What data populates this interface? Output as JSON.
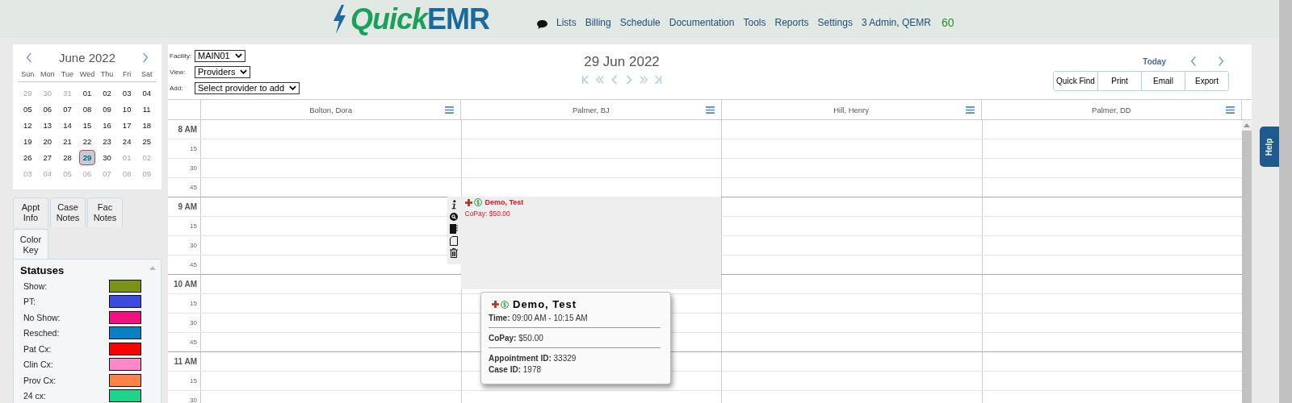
{
  "header": {
    "logo": {
      "first": "Quick",
      "second": "EMR"
    },
    "nav": [
      "Lists",
      "Billing",
      "Schedule",
      "Documentation",
      "Tools",
      "Reports",
      "Settings",
      "3 Admin, QEMR"
    ],
    "counter": "60"
  },
  "mini_calendar": {
    "month": "June 2022",
    "weekdays": [
      "Sun",
      "Mon",
      "Tue",
      "Wed",
      "Thu",
      "Fri",
      "Sat"
    ],
    "weeks": [
      [
        {
          "day": "29",
          "muted": true,
          "selected": false
        },
        {
          "day": "30",
          "muted": true,
          "selected": false
        },
        {
          "day": "31",
          "muted": true,
          "selected": false
        },
        {
          "day": "01",
          "muted": false,
          "selected": false
        },
        {
          "day": "02",
          "muted": false,
          "selected": false
        },
        {
          "day": "03",
          "muted": false,
          "selected": false
        },
        {
          "day": "04",
          "muted": false,
          "selected": false
        }
      ],
      [
        {
          "day": "05",
          "muted": false,
          "selected": false
        },
        {
          "day": "06",
          "muted": false,
          "selected": false
        },
        {
          "day": "07",
          "muted": false,
          "selected": false
        },
        {
          "day": "08",
          "muted": false,
          "selected": false
        },
        {
          "day": "09",
          "muted": false,
          "selected": false
        },
        {
          "day": "10",
          "muted": false,
          "selected": false
        },
        {
          "day": "11",
          "muted": false,
          "selected": false
        }
      ],
      [
        {
          "day": "12",
          "muted": false,
          "selected": false
        },
        {
          "day": "13",
          "muted": false,
          "selected": false
        },
        {
          "day": "14",
          "muted": false,
          "selected": false
        },
        {
          "day": "15",
          "muted": false,
          "selected": false
        },
        {
          "day": "16",
          "muted": false,
          "selected": false
        },
        {
          "day": "17",
          "muted": false,
          "selected": false
        },
        {
          "day": "18",
          "muted": false,
          "selected": false
        }
      ],
      [
        {
          "day": "19",
          "muted": false,
          "selected": false
        },
        {
          "day": "20",
          "muted": false,
          "selected": false
        },
        {
          "day": "21",
          "muted": false,
          "selected": false
        },
        {
          "day": "22",
          "muted": false,
          "selected": false
        },
        {
          "day": "23",
          "muted": false,
          "selected": false
        },
        {
          "day": "24",
          "muted": false,
          "selected": false
        },
        {
          "day": "25",
          "muted": false,
          "selected": false
        }
      ],
      [
        {
          "day": "26",
          "muted": false,
          "selected": false
        },
        {
          "day": "27",
          "muted": false,
          "selected": false
        },
        {
          "day": "28",
          "muted": false,
          "selected": false
        },
        {
          "day": "29",
          "muted": false,
          "selected": true
        },
        {
          "day": "30",
          "muted": false,
          "selected": false
        },
        {
          "day": "01",
          "muted": true,
          "selected": false
        },
        {
          "day": "02",
          "muted": true,
          "selected": false
        }
      ],
      [
        {
          "day": "03",
          "muted": true,
          "selected": false
        },
        {
          "day": "04",
          "muted": true,
          "selected": false
        },
        {
          "day": "05",
          "muted": true,
          "selected": false
        },
        {
          "day": "06",
          "muted": true,
          "selected": false
        },
        {
          "day": "07",
          "muted": true,
          "selected": false
        },
        {
          "day": "08",
          "muted": true,
          "selected": false
        },
        {
          "day": "09",
          "muted": true,
          "selected": false
        }
      ]
    ]
  },
  "side_tabs": [
    {
      "label": "Appt Info",
      "selected": false
    },
    {
      "label": "Case Notes",
      "selected": false
    },
    {
      "label": "Fac Notes",
      "selected": false
    },
    {
      "label": "Color Key",
      "selected": true
    }
  ],
  "color_key": {
    "title": "Statuses",
    "items": [
      {
        "label": "Show:",
        "color": "#7a9419"
      },
      {
        "label": "PT:",
        "color": "#3a4be0"
      },
      {
        "label": "No Show:",
        "color": "#f20f7f"
      },
      {
        "label": "Resched:",
        "color": "#0a80c4"
      },
      {
        "label": "Pat Cx:",
        "color": "#ff0000"
      },
      {
        "label": "Clin Cx:",
        "color": "#ff88c8"
      },
      {
        "label": "Prov Cx:",
        "color": "#ff8344"
      },
      {
        "label": "24 cx:",
        "color": "#1fd38a"
      }
    ]
  },
  "toolbar": {
    "filters": [
      {
        "label": "Facility:",
        "value": "MAIN01"
      },
      {
        "label": "View:",
        "value": "Providers"
      },
      {
        "label": "Add:",
        "value": "Select provider to add"
      }
    ],
    "date": "29 Jun 2022",
    "today": "Today",
    "buttons": [
      "Quick Find",
      "Print",
      "Email",
      "Export"
    ]
  },
  "providers": [
    {
      "name": "Bolton, Dora"
    },
    {
      "name": "Palmer, BJ",
      "appointments": [
        {
          "name": "Demo, Test",
          "copay_label": "CoPay:",
          "copay": "$50.00"
        }
      ]
    },
    {
      "name": "Hill, Henry"
    },
    {
      "name": "Palmer, DD"
    }
  ],
  "time_slots": [
    {
      "label": "8 AM",
      "kind": "hour"
    },
    {
      "label": "15",
      "kind": "quarter"
    },
    {
      "label": "30",
      "kind": "quarter"
    },
    {
      "label": "45",
      "kind": "quarter"
    },
    {
      "label": "9 AM",
      "kind": "hour"
    },
    {
      "label": "15",
      "kind": "quarter"
    },
    {
      "label": "30",
      "kind": "quarter"
    },
    {
      "label": "45",
      "kind": "quarter"
    },
    {
      "label": "10 AM",
      "kind": "hour"
    },
    {
      "label": "15",
      "kind": "quarter"
    },
    {
      "label": "30",
      "kind": "quarter"
    },
    {
      "label": "45",
      "kind": "quarter"
    },
    {
      "label": "11 AM",
      "kind": "hour"
    },
    {
      "label": "15",
      "kind": "quarter"
    },
    {
      "label": "30",
      "kind": "quarter"
    }
  ],
  "tooltip": {
    "name": "Demo, Test",
    "groups": [
      [
        {
          "label": "Time:",
          "value": "09:00 AM - 10:15 AM"
        }
      ],
      [
        {
          "label": "CoPay:",
          "value": "$50.00"
        }
      ],
      [
        {
          "label": "Appointment ID:",
          "value": "33329"
        },
        {
          "label": "Case ID:",
          "value": "1978"
        }
      ]
    ]
  },
  "help_tab": "Help"
}
